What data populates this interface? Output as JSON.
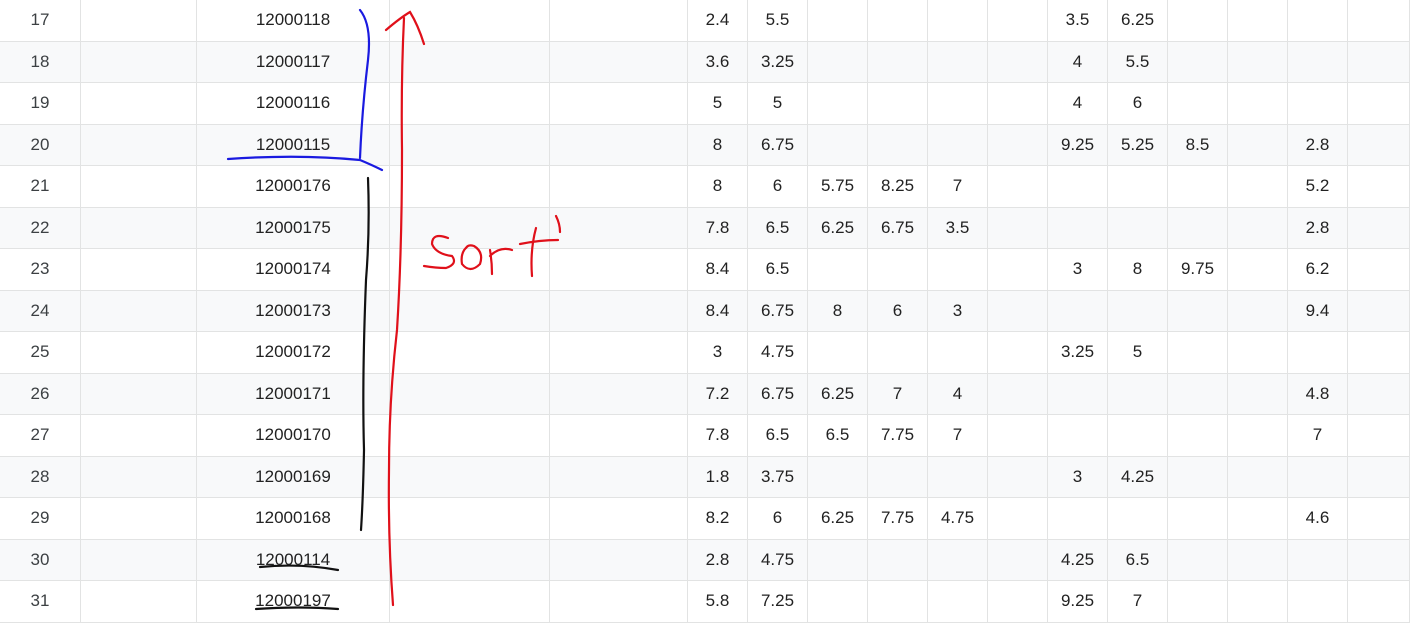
{
  "rows": [
    {
      "num": "17",
      "id": "12000118",
      "cols": [
        "2.4",
        "5.5",
        "",
        "",
        "",
        "",
        "3.5",
        "6.25",
        "",
        "",
        ""
      ]
    },
    {
      "num": "18",
      "id": "12000117",
      "cols": [
        "3.6",
        "3.25",
        "",
        "",
        "",
        "",
        "4",
        "5.5",
        "",
        "",
        ""
      ]
    },
    {
      "num": "19",
      "id": "12000116",
      "cols": [
        "5",
        "5",
        "",
        "",
        "",
        "",
        "4",
        "6",
        "",
        "",
        ""
      ]
    },
    {
      "num": "20",
      "id": "12000115",
      "cols": [
        "8",
        "6.75",
        "",
        "",
        "",
        "",
        "9.25",
        "5.25",
        "8.5",
        "",
        "2.8"
      ]
    },
    {
      "num": "21",
      "id": "12000176",
      "cols": [
        "8",
        "6",
        "5.75",
        "8.25",
        "7",
        "",
        "",
        "",
        "",
        "",
        "5.2"
      ]
    },
    {
      "num": "22",
      "id": "12000175",
      "cols": [
        "7.8",
        "6.5",
        "6.25",
        "6.75",
        "3.5",
        "",
        "",
        "",
        "",
        "",
        "2.8"
      ]
    },
    {
      "num": "23",
      "id": "12000174",
      "cols": [
        "8.4",
        "6.5",
        "",
        "",
        "",
        "",
        "3",
        "8",
        "9.75",
        "",
        "6.2"
      ]
    },
    {
      "num": "24",
      "id": "12000173",
      "cols": [
        "8.4",
        "6.75",
        "8",
        "6",
        "3",
        "",
        "",
        "",
        "",
        "",
        "9.4"
      ]
    },
    {
      "num": "25",
      "id": "12000172",
      "cols": [
        "3",
        "4.75",
        "",
        "",
        "",
        "",
        "3.25",
        "5",
        "",
        "",
        ""
      ]
    },
    {
      "num": "26",
      "id": "12000171",
      "cols": [
        "7.2",
        "6.75",
        "6.25",
        "7",
        "4",
        "",
        "",
        "",
        "",
        "",
        "4.8"
      ]
    },
    {
      "num": "27",
      "id": "12000170",
      "cols": [
        "7.8",
        "6.5",
        "6.5",
        "7.75",
        "7",
        "",
        "",
        "",
        "",
        "",
        "7"
      ]
    },
    {
      "num": "28",
      "id": "12000169",
      "cols": [
        "1.8",
        "3.75",
        "",
        "",
        "",
        "",
        "3",
        "4.25",
        "",
        "",
        ""
      ]
    },
    {
      "num": "29",
      "id": "12000168",
      "cols": [
        "8.2",
        "6",
        "6.25",
        "7.75",
        "4.75",
        "",
        "",
        "",
        "",
        "",
        "4.6"
      ]
    },
    {
      "num": "30",
      "id": "12000114",
      "cols": [
        "2.8",
        "4.75",
        "",
        "",
        "",
        "",
        "4.25",
        "6.5",
        "",
        "",
        ""
      ]
    },
    {
      "num": "31",
      "id": "12000197",
      "cols": [
        "5.8",
        "7.25",
        "",
        "",
        "",
        "",
        "9.25",
        "7",
        "",
        "",
        ""
      ]
    }
  ],
  "annotation": {
    "text": "Sort",
    "colors": {
      "blue": "#1a1ae0",
      "red": "#e0101a",
      "black": "#111111"
    }
  }
}
